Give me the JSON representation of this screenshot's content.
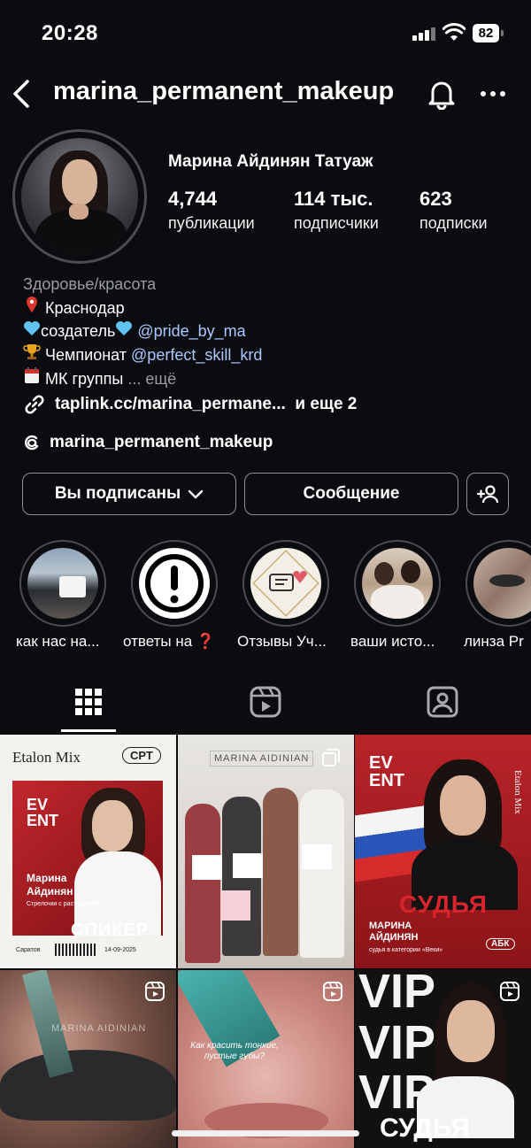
{
  "status_bar": {
    "time": "20:28",
    "battery": "82"
  },
  "header": {
    "username": "marina_permanent_makeup"
  },
  "profile": {
    "full_name": "Марина Айдинян Татуаж",
    "stats": [
      {
        "value": "4,744",
        "label": "публикации"
      },
      {
        "value": "114 тыс.",
        "label": "подписчики"
      },
      {
        "value": "623",
        "label": "подписки"
      }
    ],
    "category": "Здоровье/красота",
    "bio_lines": {
      "location": "Краснодар",
      "creator_prefix": "создатель",
      "creator_handle": "@pride_by_ma",
      "champ_prefix": "Чемпионат",
      "champ_handle": "@perfect_skill_krd",
      "groups": "МК группы",
      "groups_more": "... ещё"
    },
    "link": "taplink.cc/marina_permane...",
    "link_more": "и еще 2",
    "threads": "marina_permanent_makeup"
  },
  "buttons": {
    "following": "Вы подписаны",
    "message": "Сообщение"
  },
  "highlights": [
    {
      "label": "как нас на..."
    },
    {
      "label": "ответы на ❓"
    },
    {
      "label": "Отзывы Уч..."
    },
    {
      "label": "ваши исто..."
    },
    {
      "label": "линза Pr"
    }
  ],
  "grid": {
    "post1": {
      "brand": "Etalon Mix",
      "badge": "СРТ",
      "event": "EV ENT",
      "name_line1": "Марина",
      "name_line2": "Айдинян",
      "subtitle": "Стрелочки с растушевкой",
      "speaker": "СПИКЕР",
      "city": "Саратов",
      "date": "14-09-2025"
    },
    "post2": {
      "sign": "MARINA AIDINIAN"
    },
    "post3": {
      "event": "EV ENT",
      "brand": "Etalon Mix",
      "judge": "СУДЬЯ",
      "name_line1": "МАРИНА",
      "name_line2": "АЙДИНЯН",
      "category": "судья в категории «Веки»",
      "badge": "АБК"
    },
    "post4": {
      "watermark": "MARINA AIDINIAN"
    },
    "post5": {
      "caption": "Как красить тонкие, пустые губы?"
    },
    "post6": {
      "vip": "VIP",
      "judge": "СУДЬЯ"
    }
  }
}
